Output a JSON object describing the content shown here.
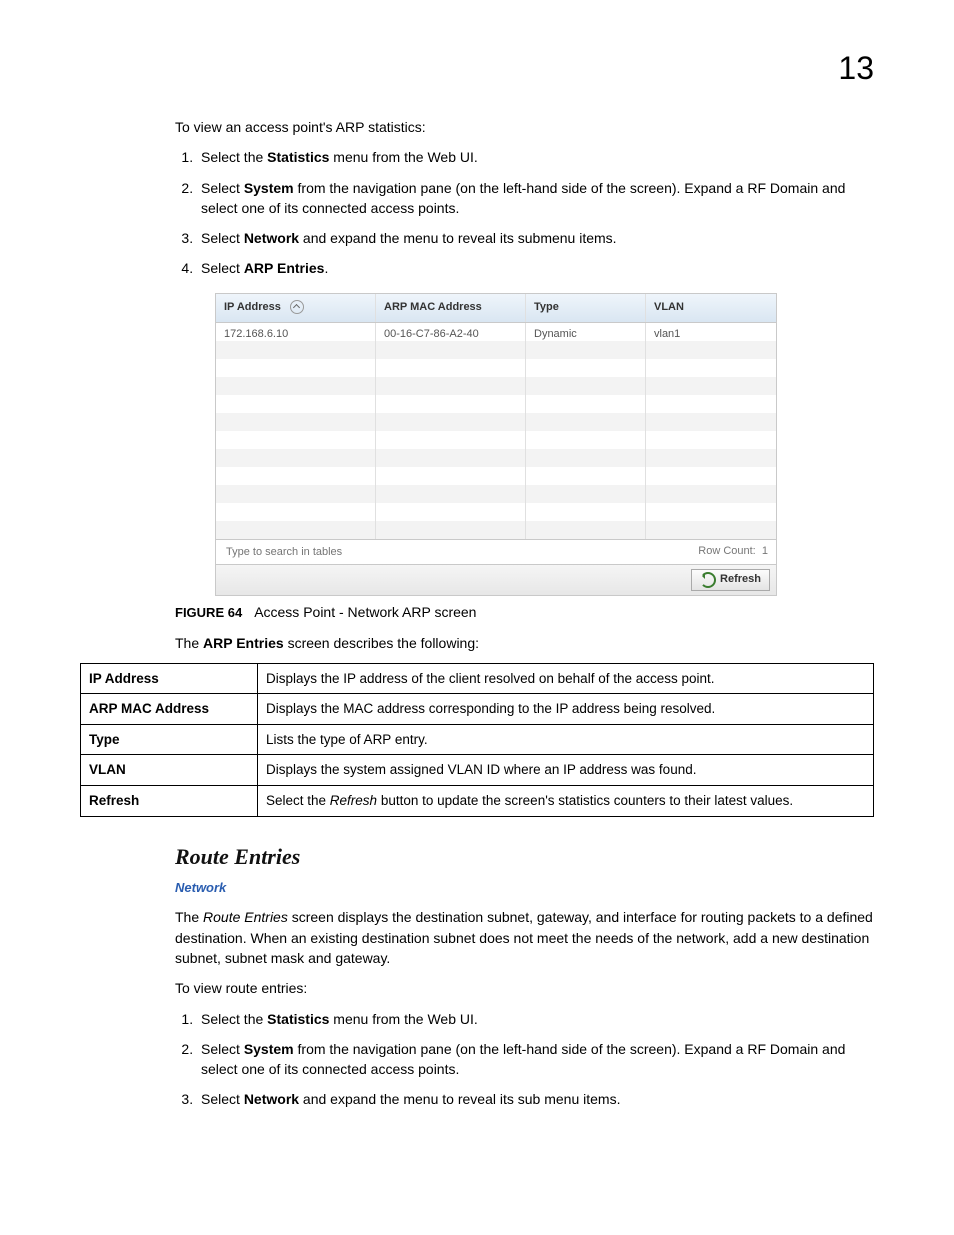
{
  "pagenum": "13",
  "arp": {
    "intro": "To view an access point's ARP statistics:",
    "steps": [
      {
        "pre": "Select the ",
        "b": "Statistics",
        "post": " menu from the Web UI."
      },
      {
        "pre": "Select ",
        "b": "System",
        "post": " from the navigation pane (on the left-hand side of the screen). Expand a RF Domain and select one of its connected access points."
      },
      {
        "pre": "Select ",
        "b": "Network",
        "post": " and expand the menu to reveal its submenu items."
      },
      {
        "pre": "Select ",
        "b": "ARP Entries",
        "post": "."
      }
    ]
  },
  "shot": {
    "headers": {
      "ip": "IP Address",
      "mac": "ARP MAC Address",
      "type": "Type",
      "vlan": "VLAN"
    },
    "row": {
      "ip": "172.168.6.10",
      "mac": "00-16-C7-86-A2-40",
      "type": "Dynamic",
      "vlan": "vlan1"
    },
    "search_placeholder": "Type to search in tables",
    "rowcount_label": "Row Count:",
    "rowcount_value": "1",
    "refresh": "Refresh"
  },
  "figure": {
    "num": "FIGURE 64",
    "caption": "Access Point - Network ARP screen"
  },
  "desc_intro_pre": "The ",
  "desc_intro_b": "ARP Entries",
  "desc_intro_post": " screen describes the following:",
  "defs": [
    {
      "k": "IP Address",
      "v": "Displays the IP address of the client resolved on behalf of the access point."
    },
    {
      "k": "ARP MAC Address",
      "v": "Displays the MAC address corresponding to the IP address being resolved."
    },
    {
      "k": "Type",
      "v": "Lists the type of ARP entry."
    },
    {
      "k": "VLAN",
      "v": "Displays the system assigned VLAN ID where an IP address was found."
    },
    {
      "k": "Refresh",
      "pre": "Select the ",
      "it": "Refresh",
      "post": " button to update the screen's statistics counters to their latest values."
    }
  ],
  "route": {
    "title": "Route Entries",
    "crumb": "Network",
    "para_pre": "The ",
    "para_it": "Route Entries",
    "para_post": " screen displays the destination subnet, gateway, and interface for routing packets to a defined destination. When an existing destination subnet does not meet the needs of the network, add a new destination subnet, subnet mask and gateway.",
    "intro": "To view route entries:",
    "steps": [
      {
        "pre": "Select the ",
        "b": "Statistics",
        "post": " menu from the Web UI."
      },
      {
        "pre": "Select ",
        "b": "System",
        "post": " from the navigation pane (on the left-hand side of the screen). Expand a RF Domain and select one of its connected access points."
      },
      {
        "pre": "Select ",
        "b": "Network",
        "post": " and expand the menu to reveal its sub menu items."
      }
    ]
  }
}
